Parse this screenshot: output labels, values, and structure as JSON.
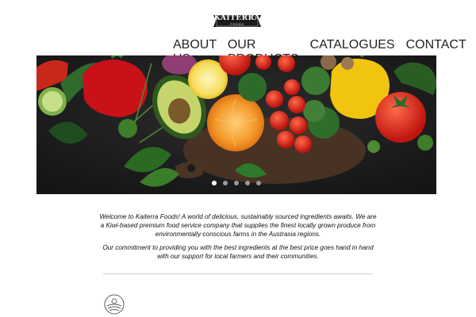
{
  "brand": {
    "name": "KAITERRA",
    "sub": "FOODS"
  },
  "nav": {
    "items": [
      {
        "label": "ABOUT US",
        "active": true
      },
      {
        "label": "OUR PRODUCTS",
        "active": false
      },
      {
        "label": "CATALOGUES",
        "active": false
      },
      {
        "label": "CONTACT",
        "active": false
      }
    ]
  },
  "hero": {
    "slide_count": 5,
    "active_slide": 1
  },
  "intro": {
    "paragraph1": "Welcome to Kaiterra Foods! A world of delicious, sustainably sourced ingredients awaits. We are a Kiwi-based premium food service company that supplies the finest locally grown produce from environmentally conscious farms in the Austrasia regions.",
    "paragraph2": "Our commitment to providing you with the best ingredients at the best price goes hand in hand with our support for local farmers and their communities."
  },
  "colors": {
    "accent": "#111111",
    "hero_bg": "#1c1c1c"
  }
}
